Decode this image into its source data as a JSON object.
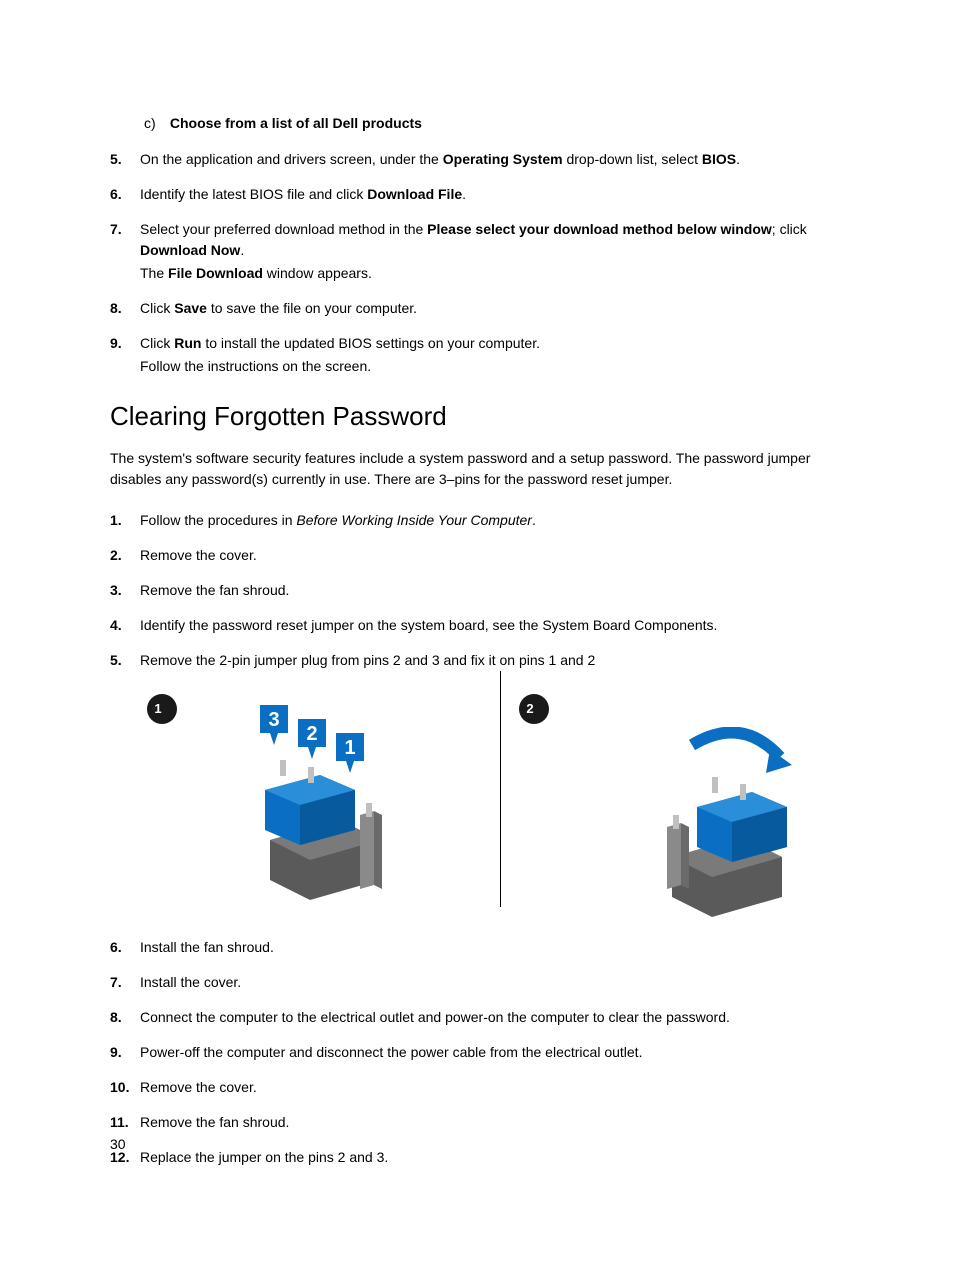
{
  "sublist": {
    "letter": "c)",
    "text": "Choose from a list of all Dell products"
  },
  "topSteps": [
    {
      "n": "5.",
      "parts": [
        {
          "t": "On the application and drivers screen, under the ",
          "b": false
        },
        {
          "t": "Operating System",
          "b": true
        },
        {
          "t": " drop-down list, select ",
          "b": false
        },
        {
          "t": "BIOS",
          "b": true
        },
        {
          "t": ".",
          "b": false
        }
      ]
    },
    {
      "n": "6.",
      "parts": [
        {
          "t": "Identify the latest BIOS file and click ",
          "b": false
        },
        {
          "t": "Download File",
          "b": true
        },
        {
          "t": ".",
          "b": false
        }
      ]
    },
    {
      "n": "7.",
      "line1parts": [
        {
          "t": "Select your preferred download method in the ",
          "b": false
        },
        {
          "t": "Please select your download method below window",
          "b": true
        },
        {
          "t": "; click ",
          "b": false
        },
        {
          "t": "Download Now",
          "b": true
        },
        {
          "t": ".",
          "b": false
        }
      ],
      "line2parts": [
        {
          "t": "The ",
          "b": false
        },
        {
          "t": "File Download",
          "b": true
        },
        {
          "t": " window appears.",
          "b": false
        }
      ]
    },
    {
      "n": "8.",
      "parts": [
        {
          "t": "Click ",
          "b": false
        },
        {
          "t": "Save",
          "b": true
        },
        {
          "t": " to save the file on your computer.",
          "b": false
        }
      ]
    },
    {
      "n": "9.",
      "line1parts": [
        {
          "t": "Click ",
          "b": false
        },
        {
          "t": "Run",
          "b": true
        },
        {
          "t": " to install the updated BIOS settings on your computer.",
          "b": false
        }
      ],
      "line2parts": [
        {
          "t": "Follow the instructions on the screen.",
          "b": false
        }
      ]
    }
  ],
  "heading": "Clearing Forgotten Password",
  "intro": "The system's software security features include a system password and a setup password. The password jumper disables any password(s) currently in use. There are 3–pins for the password reset jumper.",
  "steps1": [
    {
      "n": "1.",
      "parts": [
        {
          "t": "Follow the procedures in ",
          "b": false,
          "i": false
        },
        {
          "t": "Before Working Inside Your Computer",
          "b": false,
          "i": true
        },
        {
          "t": ".",
          "b": false,
          "i": false
        }
      ]
    },
    {
      "n": "2.",
      "parts": [
        {
          "t": "Remove the cover.",
          "b": false
        }
      ]
    },
    {
      "n": "3.",
      "parts": [
        {
          "t": "Remove the fan shroud.",
          "b": false
        }
      ]
    },
    {
      "n": "4.",
      "parts": [
        {
          "t": "Identify the password reset jumper on the system board, see the System Board Components.",
          "b": false
        }
      ]
    },
    {
      "n": "5.",
      "parts": [
        {
          "t": "Remove the 2-pin jumper plug from pins 2 and 3 and fix it on pins 1 and 2",
          "b": false
        }
      ]
    }
  ],
  "markers": {
    "one": "1",
    "two": "2"
  },
  "pinLabels": {
    "p1": "1",
    "p2": "2",
    "p3": "3"
  },
  "steps2": [
    {
      "n": "6.",
      "t": "Install the fan shroud."
    },
    {
      "n": "7.",
      "t": "Install the cover."
    },
    {
      "n": "8.",
      "t": "Connect the computer to the electrical outlet and power-on the computer to clear the password."
    },
    {
      "n": "9.",
      "t": "Power-off the computer and disconnect the power cable from the electrical outlet."
    },
    {
      "n": "10.",
      "t": "Remove the cover."
    },
    {
      "n": "11.",
      "t": "Remove the fan shroud."
    },
    {
      "n": "12.",
      "t": "Replace the jumper on the pins 2 and 3."
    }
  ],
  "pageNumber": "30"
}
